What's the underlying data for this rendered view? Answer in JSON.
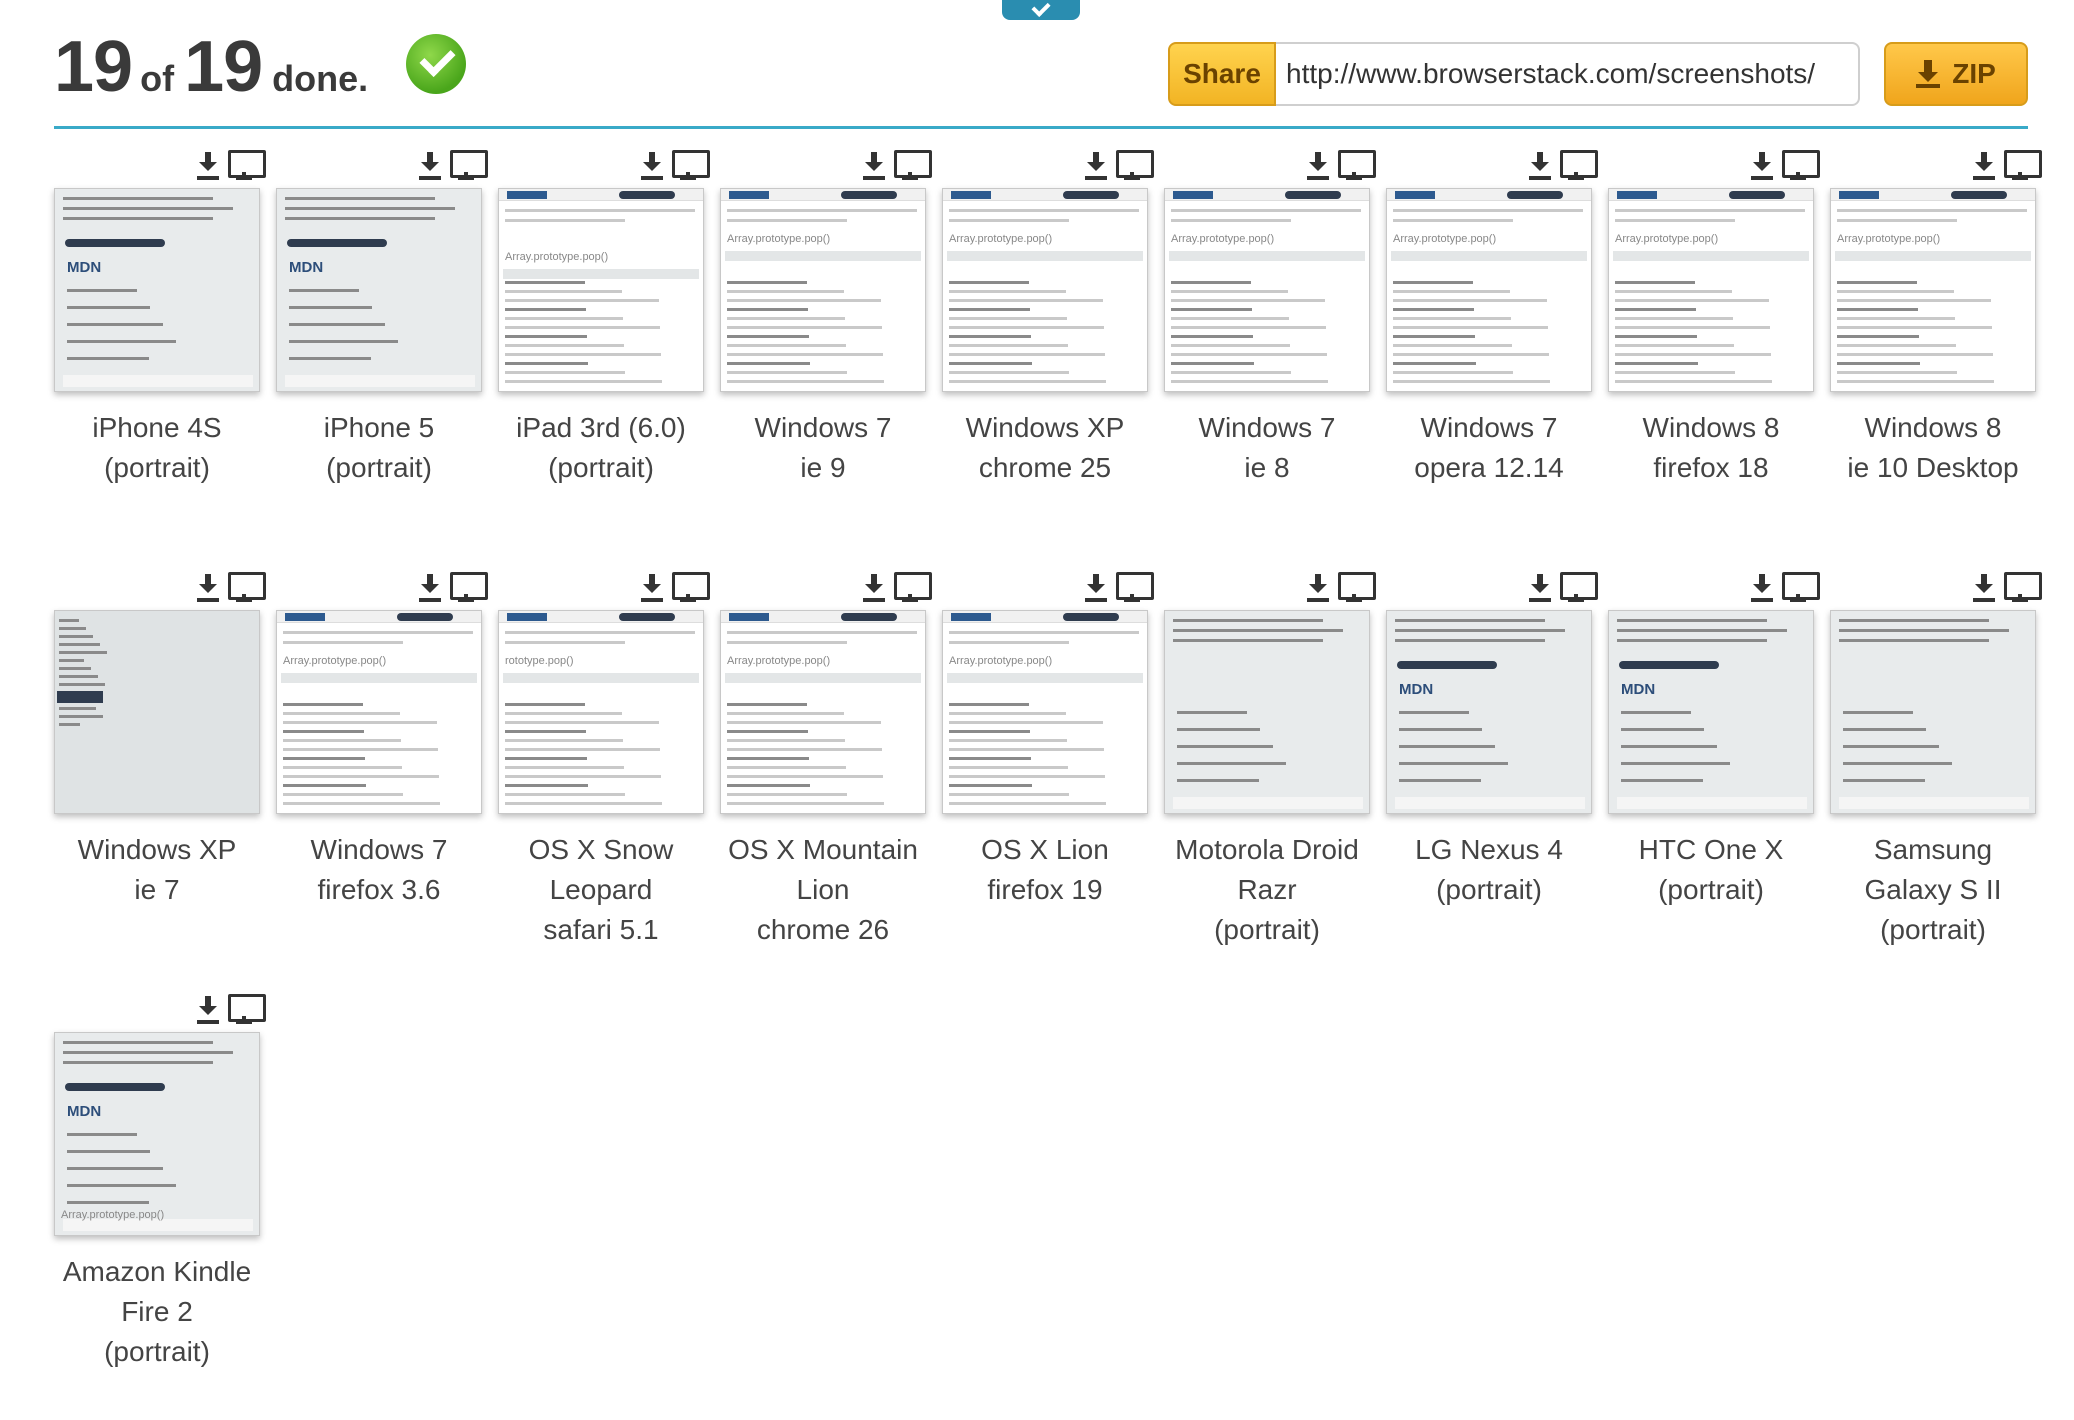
{
  "status": {
    "done_count": "19",
    "of_label": "of",
    "total": "19",
    "done_label": "done."
  },
  "share": {
    "button_label": "Share",
    "url": "http://www.browserstack.com/screenshots/",
    "zip_label": "ZIP"
  },
  "thumb_texts": {
    "mdn": "MDN",
    "array_pop": "Array.prototype.pop()",
    "prototype_pop": "rototype.pop()"
  },
  "colors": {
    "accent": "#39aac8",
    "share_button": "#f2b424",
    "zip_button": "#f0a51c",
    "success": "#4aa61b"
  },
  "screenshots": [
    {
      "line1": "iPhone 4S",
      "line2": "(portrait)",
      "line3": ""
    },
    {
      "line1": "iPhone 5",
      "line2": "(portrait)",
      "line3": ""
    },
    {
      "line1": "iPad 3rd (6.0)",
      "line2": "(portrait)",
      "line3": ""
    },
    {
      "line1": "Windows 7",
      "line2": "ie 9",
      "line3": ""
    },
    {
      "line1": "Windows XP",
      "line2": "chrome 25",
      "line3": ""
    },
    {
      "line1": "Windows 7",
      "line2": "ie 8",
      "line3": ""
    },
    {
      "line1": "Windows 7",
      "line2": "opera 12.14",
      "line3": ""
    },
    {
      "line1": "Windows 8",
      "line2": "firefox 18",
      "line3": ""
    },
    {
      "line1": "Windows 8",
      "line2": "ie 10 Desktop",
      "line3": ""
    },
    {
      "line1": "Windows XP",
      "line2": "ie 7",
      "line3": ""
    },
    {
      "line1": "Windows 7",
      "line2": "firefox 3.6",
      "line3": ""
    },
    {
      "line1": "OS X Snow",
      "line2": "Leopard",
      "line3": "safari 5.1"
    },
    {
      "line1": "OS X Mountain",
      "line2": "Lion",
      "line3": "chrome 26"
    },
    {
      "line1": "OS X Lion",
      "line2": "firefox 19",
      "line3": ""
    },
    {
      "line1": "Motorola Droid",
      "line2": "Razr",
      "line3": "(portrait)"
    },
    {
      "line1": "LG Nexus 4",
      "line2": "(portrait)",
      "line3": ""
    },
    {
      "line1": "HTC One X",
      "line2": "(portrait)",
      "line3": ""
    },
    {
      "line1": "Samsung",
      "line2": "Galaxy S II",
      "line3": "(portrait)"
    },
    {
      "line1": "Amazon Kindle",
      "line2": "Fire 2",
      "line3": "(portrait)"
    }
  ]
}
